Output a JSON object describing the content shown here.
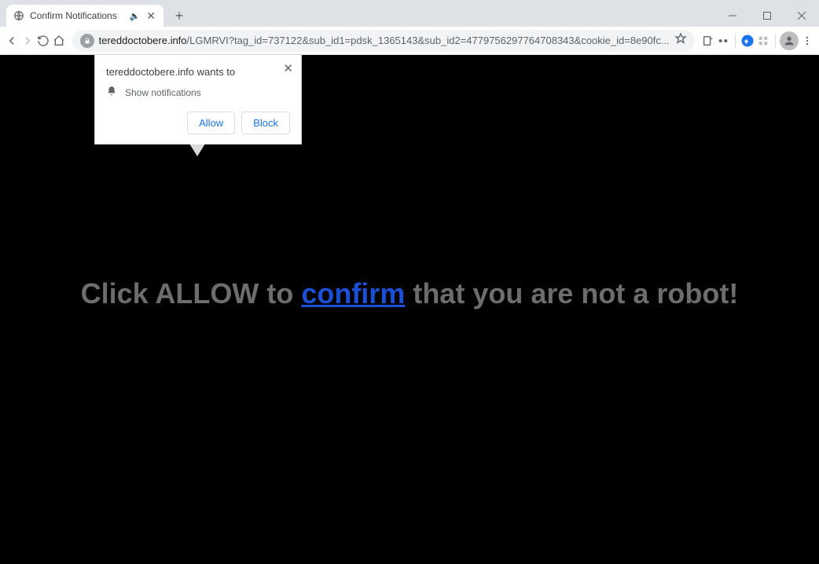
{
  "tab": {
    "title": "Confirm Notifications"
  },
  "url": {
    "domain": "tereddoctobere.info",
    "path": "/LGMRVI?tag_id=737122&sub_id1=pdsk_1365143&sub_id2=4779756297764708343&cookie_id=8e90fc..."
  },
  "popup": {
    "title": "tereddoctobere.info wants to",
    "permission": "Show notifications",
    "allow": "Allow",
    "block": "Block"
  },
  "page": {
    "pre": "Click ALLOW to ",
    "link": "confirm",
    "post": " that you are not a robot!"
  }
}
